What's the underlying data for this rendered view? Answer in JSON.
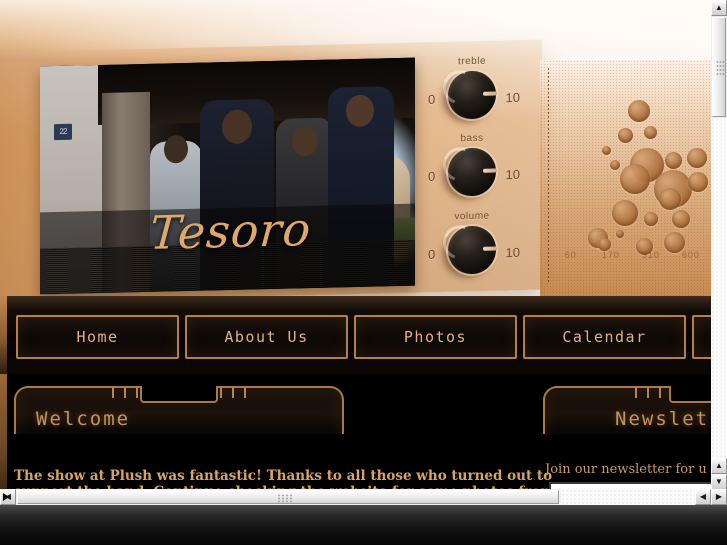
{
  "site": {
    "band_name": "Tesoro",
    "photo_number_plate": "22"
  },
  "amp_controls": [
    {
      "label": "treble",
      "min": "0",
      "max": "10"
    },
    {
      "label": "bass",
      "min": "0",
      "max": "10"
    },
    {
      "label": "volume",
      "min": "0",
      "max": "10"
    }
  ],
  "frequency_scale": [
    "60",
    "170",
    "310",
    "600"
  ],
  "nav": {
    "items": [
      {
        "label": "Home"
      },
      {
        "label": "About Us"
      },
      {
        "label": "Photos"
      },
      {
        "label": "Calendar"
      },
      {
        "label": ""
      }
    ]
  },
  "welcome": {
    "title": "Welcome",
    "line1": "The show at Plush was fantastic!  Thanks to all those who turned out to",
    "line2": "support the band.  Continue checking the website for some photos from"
  },
  "newsletter": {
    "title": "Newslet",
    "blurb": "Join our newsletter for u",
    "email_value": "",
    "email_placeholder": ""
  },
  "scrollbars": {
    "vertical": {
      "up_glyph": "▲",
      "down_glyph": "▼"
    },
    "horizontal": {
      "left_glyph": "◀",
      "right_glyph": "▶"
    }
  },
  "colors": {
    "accent_gold": "#c2935d",
    "panel_border": "#a97a46",
    "amp_tan": "#dfab78",
    "body_text": "#d9a463",
    "page_bg": "#000000"
  }
}
